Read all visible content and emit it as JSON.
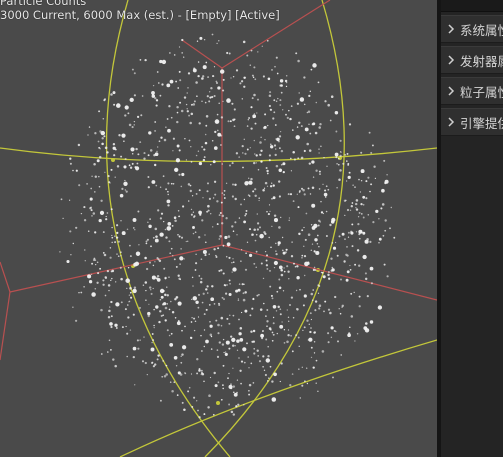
{
  "viewport": {
    "stats_title": "Particle Counts",
    "stats_line": "3000 Current, 6000 Max (est.) - [Empty] [Active]",
    "colors": {
      "background": "#4a4a4a",
      "particle": "#f2f2f2",
      "grid_yellow": "#c3c73a",
      "grid_red": "#b85050"
    }
  },
  "details_panel": {
    "categories": [
      {
        "label": "系统属性",
        "icon": "chevron-right-icon"
      },
      {
        "label": "发射器属性",
        "icon": "chevron-right-icon"
      },
      {
        "label": "粒子属性",
        "icon": "chevron-right-icon"
      },
      {
        "label": "引擎提供",
        "icon": "chevron-right-icon"
      }
    ]
  }
}
